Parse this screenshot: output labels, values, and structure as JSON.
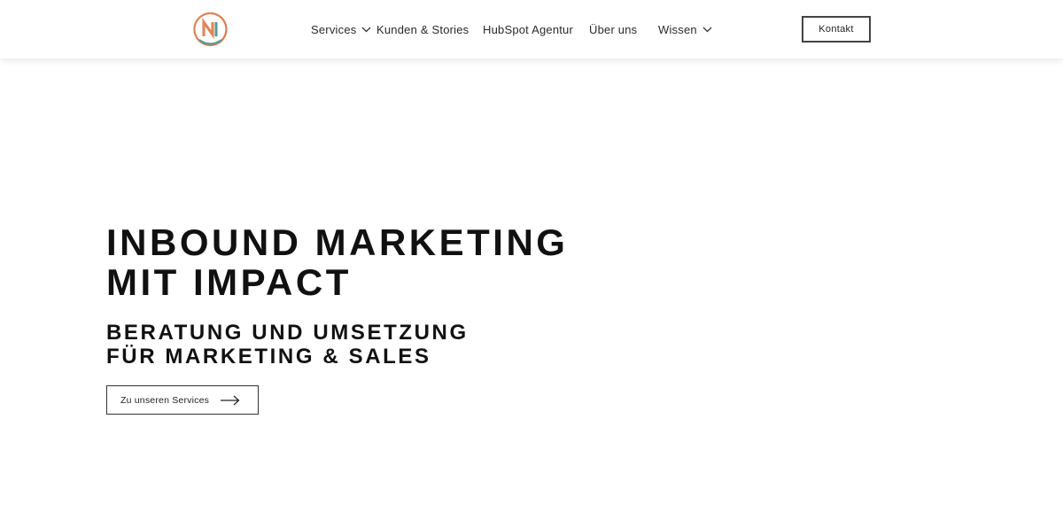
{
  "header": {
    "logo_icon": "ni-circle-logo-icon",
    "nav": [
      {
        "label": "Services",
        "has_dropdown": true
      },
      {
        "label": "Kunden & Stories",
        "has_dropdown": false
      },
      {
        "label": "HubSpot Agentur",
        "has_dropdown": false
      },
      {
        "label": "Über uns",
        "has_dropdown": false
      },
      {
        "label": "Wissen",
        "has_dropdown": true
      }
    ],
    "contact_label": "Kontakt"
  },
  "hero": {
    "title_line1": "INBOUND MARKETING",
    "title_line2": "MIT IMPACT",
    "subtitle_line1": "BERATUNG UND UMSETZUNG",
    "subtitle_line2": "FÜR MARKETING & SALES",
    "cta_label": "Zu unseren Services",
    "cta_icon": "arrow-right-icon"
  },
  "colors": {
    "text": "#111111",
    "logo_orange": "#e0875a",
    "logo_teal": "#4f9e9a"
  }
}
